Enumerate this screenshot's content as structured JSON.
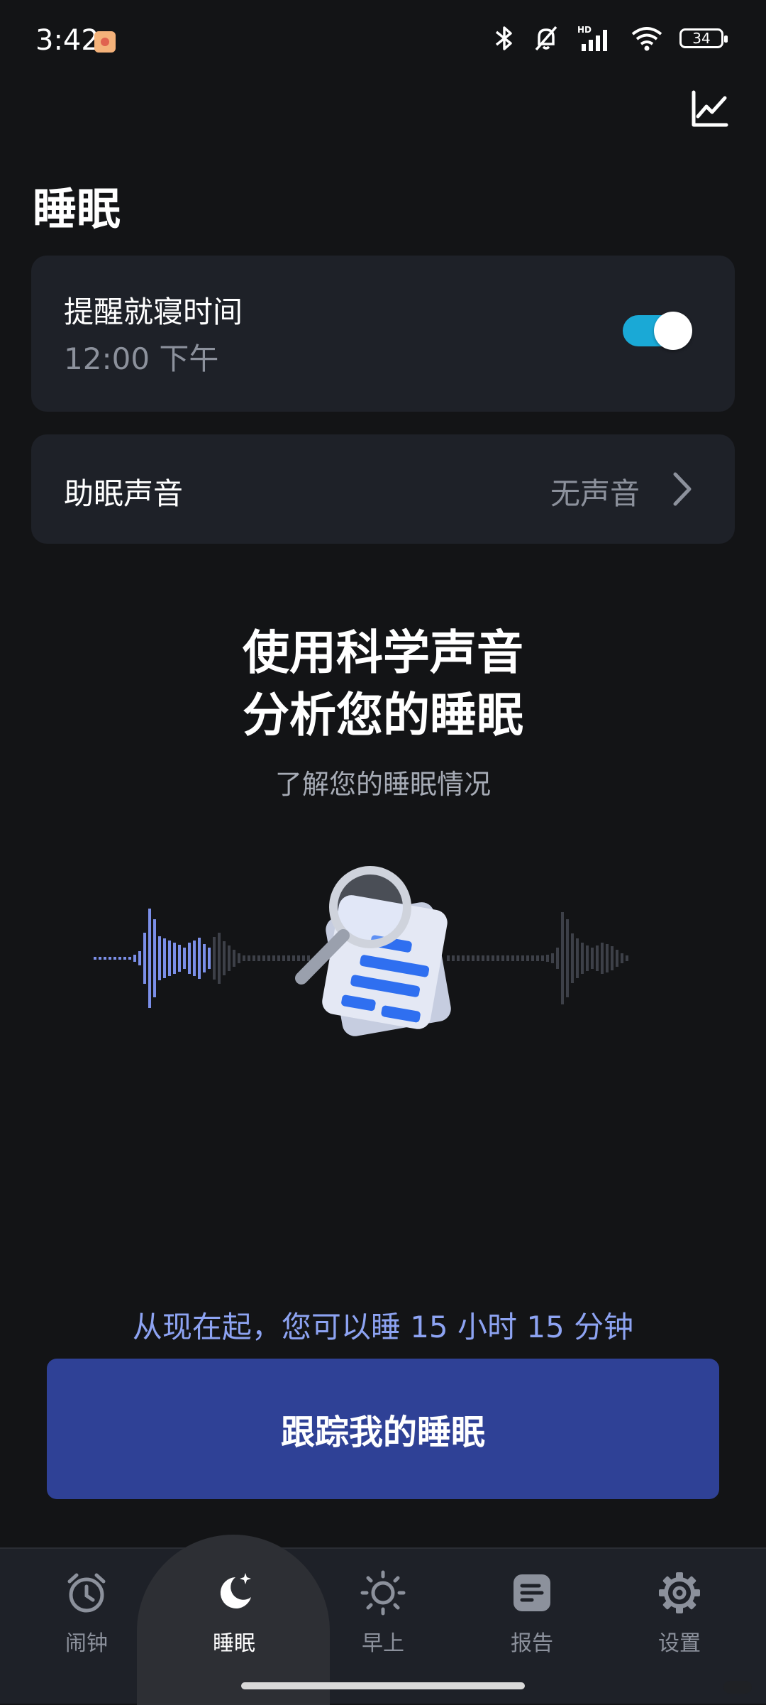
{
  "status_bar": {
    "time": "3:42",
    "battery": "34",
    "icons": [
      "app-notification-icon",
      "bluetooth-icon",
      "mute-bell-icon",
      "hd-signal-icon",
      "wifi-icon",
      "battery-icon"
    ]
  },
  "header": {
    "title": "睡眠",
    "chart_icon": "chart-icon"
  },
  "reminder": {
    "title": "提醒就寝时间",
    "time": "12:00 下午",
    "enabled": true
  },
  "sleep_sound": {
    "label": "助眠声音",
    "value": "无声音"
  },
  "promo": {
    "line1": "使用科学声音",
    "line2": "分析您的睡眠",
    "subtitle": "了解您的睡眠情况"
  },
  "sleep_hint": "从现在起，您可以睡 15 小时 15 分钟",
  "track_button": "跟踪我的睡眠",
  "nav": {
    "items": [
      {
        "label": "闹钟",
        "icon": "alarm-clock-icon"
      },
      {
        "label": "睡眠",
        "icon": "moon-icon"
      },
      {
        "label": "早上",
        "icon": "sun-icon"
      },
      {
        "label": "报告",
        "icon": "report-icon"
      },
      {
        "label": "设置",
        "icon": "gear-icon"
      }
    ],
    "active_index": 1
  },
  "colors": {
    "background": "#131416",
    "card": "#1e2128",
    "accent_toggle": "#1aa9d6",
    "button": "#2f4196",
    "hint_text": "#8da3f2",
    "wave_left": "#7b8fe8"
  }
}
